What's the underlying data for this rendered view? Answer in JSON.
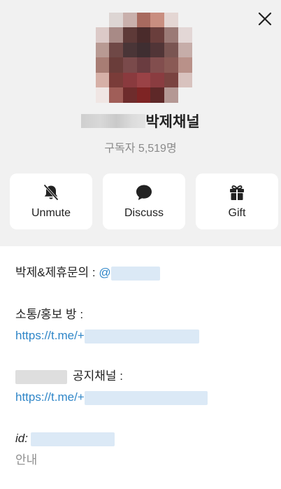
{
  "header": {
    "channel_name_suffix": "박제채널",
    "subscribers": "구독자 5,519명"
  },
  "actions": [
    {
      "label": "Unmute",
      "icon": "bell-off-icon"
    },
    {
      "label": "Discuss",
      "icon": "chat-bubble-icon"
    },
    {
      "label": "Gift",
      "icon": "gift-icon"
    }
  ],
  "info": {
    "line1_label": "박제&제휴문의 : ",
    "line1_handle": "@",
    "line2_label": "소통/홍보 방 :",
    "line2_link": "https://t.me/+",
    "line3_label": "공지채널 :",
    "line3_link": "https://t.me/+",
    "id_label": "id:",
    "id_sub": "안내"
  },
  "colors": {
    "header_bg": "#f1f1f1",
    "link": "#2f86c8",
    "muted": "#8e8e8e"
  }
}
